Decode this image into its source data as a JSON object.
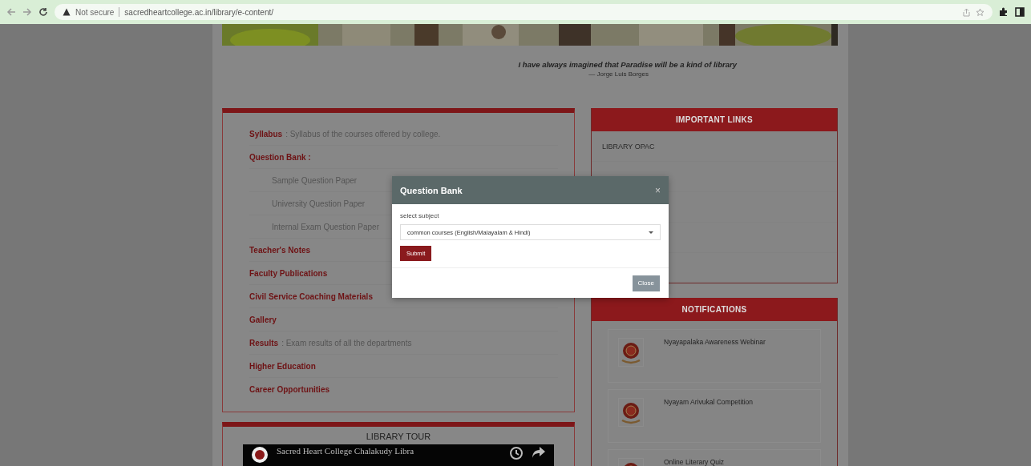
{
  "browser": {
    "security": "Not secure",
    "url": "sacredheartcollege.ac.in/library/e-content/"
  },
  "quote": {
    "text": "I have always imagined that Paradise will be a kind of library",
    "author": "— Jorge Luis Borges"
  },
  "resources": [
    {
      "title": "Syllabus",
      "description": ": Syllabus of the courses offered by college."
    },
    {
      "title": "Question Bank :",
      "children": [
        "Sample Question Paper",
        "University Question Paper",
        "Internal Exam Question Paper"
      ]
    },
    {
      "title": "Teacher's Notes"
    },
    {
      "title": "Faculty Publications"
    },
    {
      "title": "Civil Service Coaching Materials"
    },
    {
      "title": "Gallery"
    },
    {
      "title": "Results",
      "description": ": Exam results of all the departments"
    },
    {
      "title": "Higher Education"
    },
    {
      "title": "Career Opportunities"
    }
  ],
  "important_links": {
    "title": "IMPORTANT LINKS",
    "items": [
      "LIBRARY OPAC"
    ]
  },
  "notifications": {
    "title": "NOTIFICATIONS",
    "items": [
      "Nyayapalaka Awareness Webinar",
      "Nyayam Arivukal Competition",
      "Online Literary Quiz"
    ]
  },
  "library_tour": {
    "title": "LIBRARY TOUR",
    "video_title": "Sacred Heart College Chalakudy Libra"
  },
  "modal": {
    "title": "Question Bank",
    "close_symbol": "×",
    "field_label": "select subject",
    "select_value": "common courses (English/Malayalam & Hindi)",
    "submit_label": "Submit",
    "close_label": "Close"
  }
}
